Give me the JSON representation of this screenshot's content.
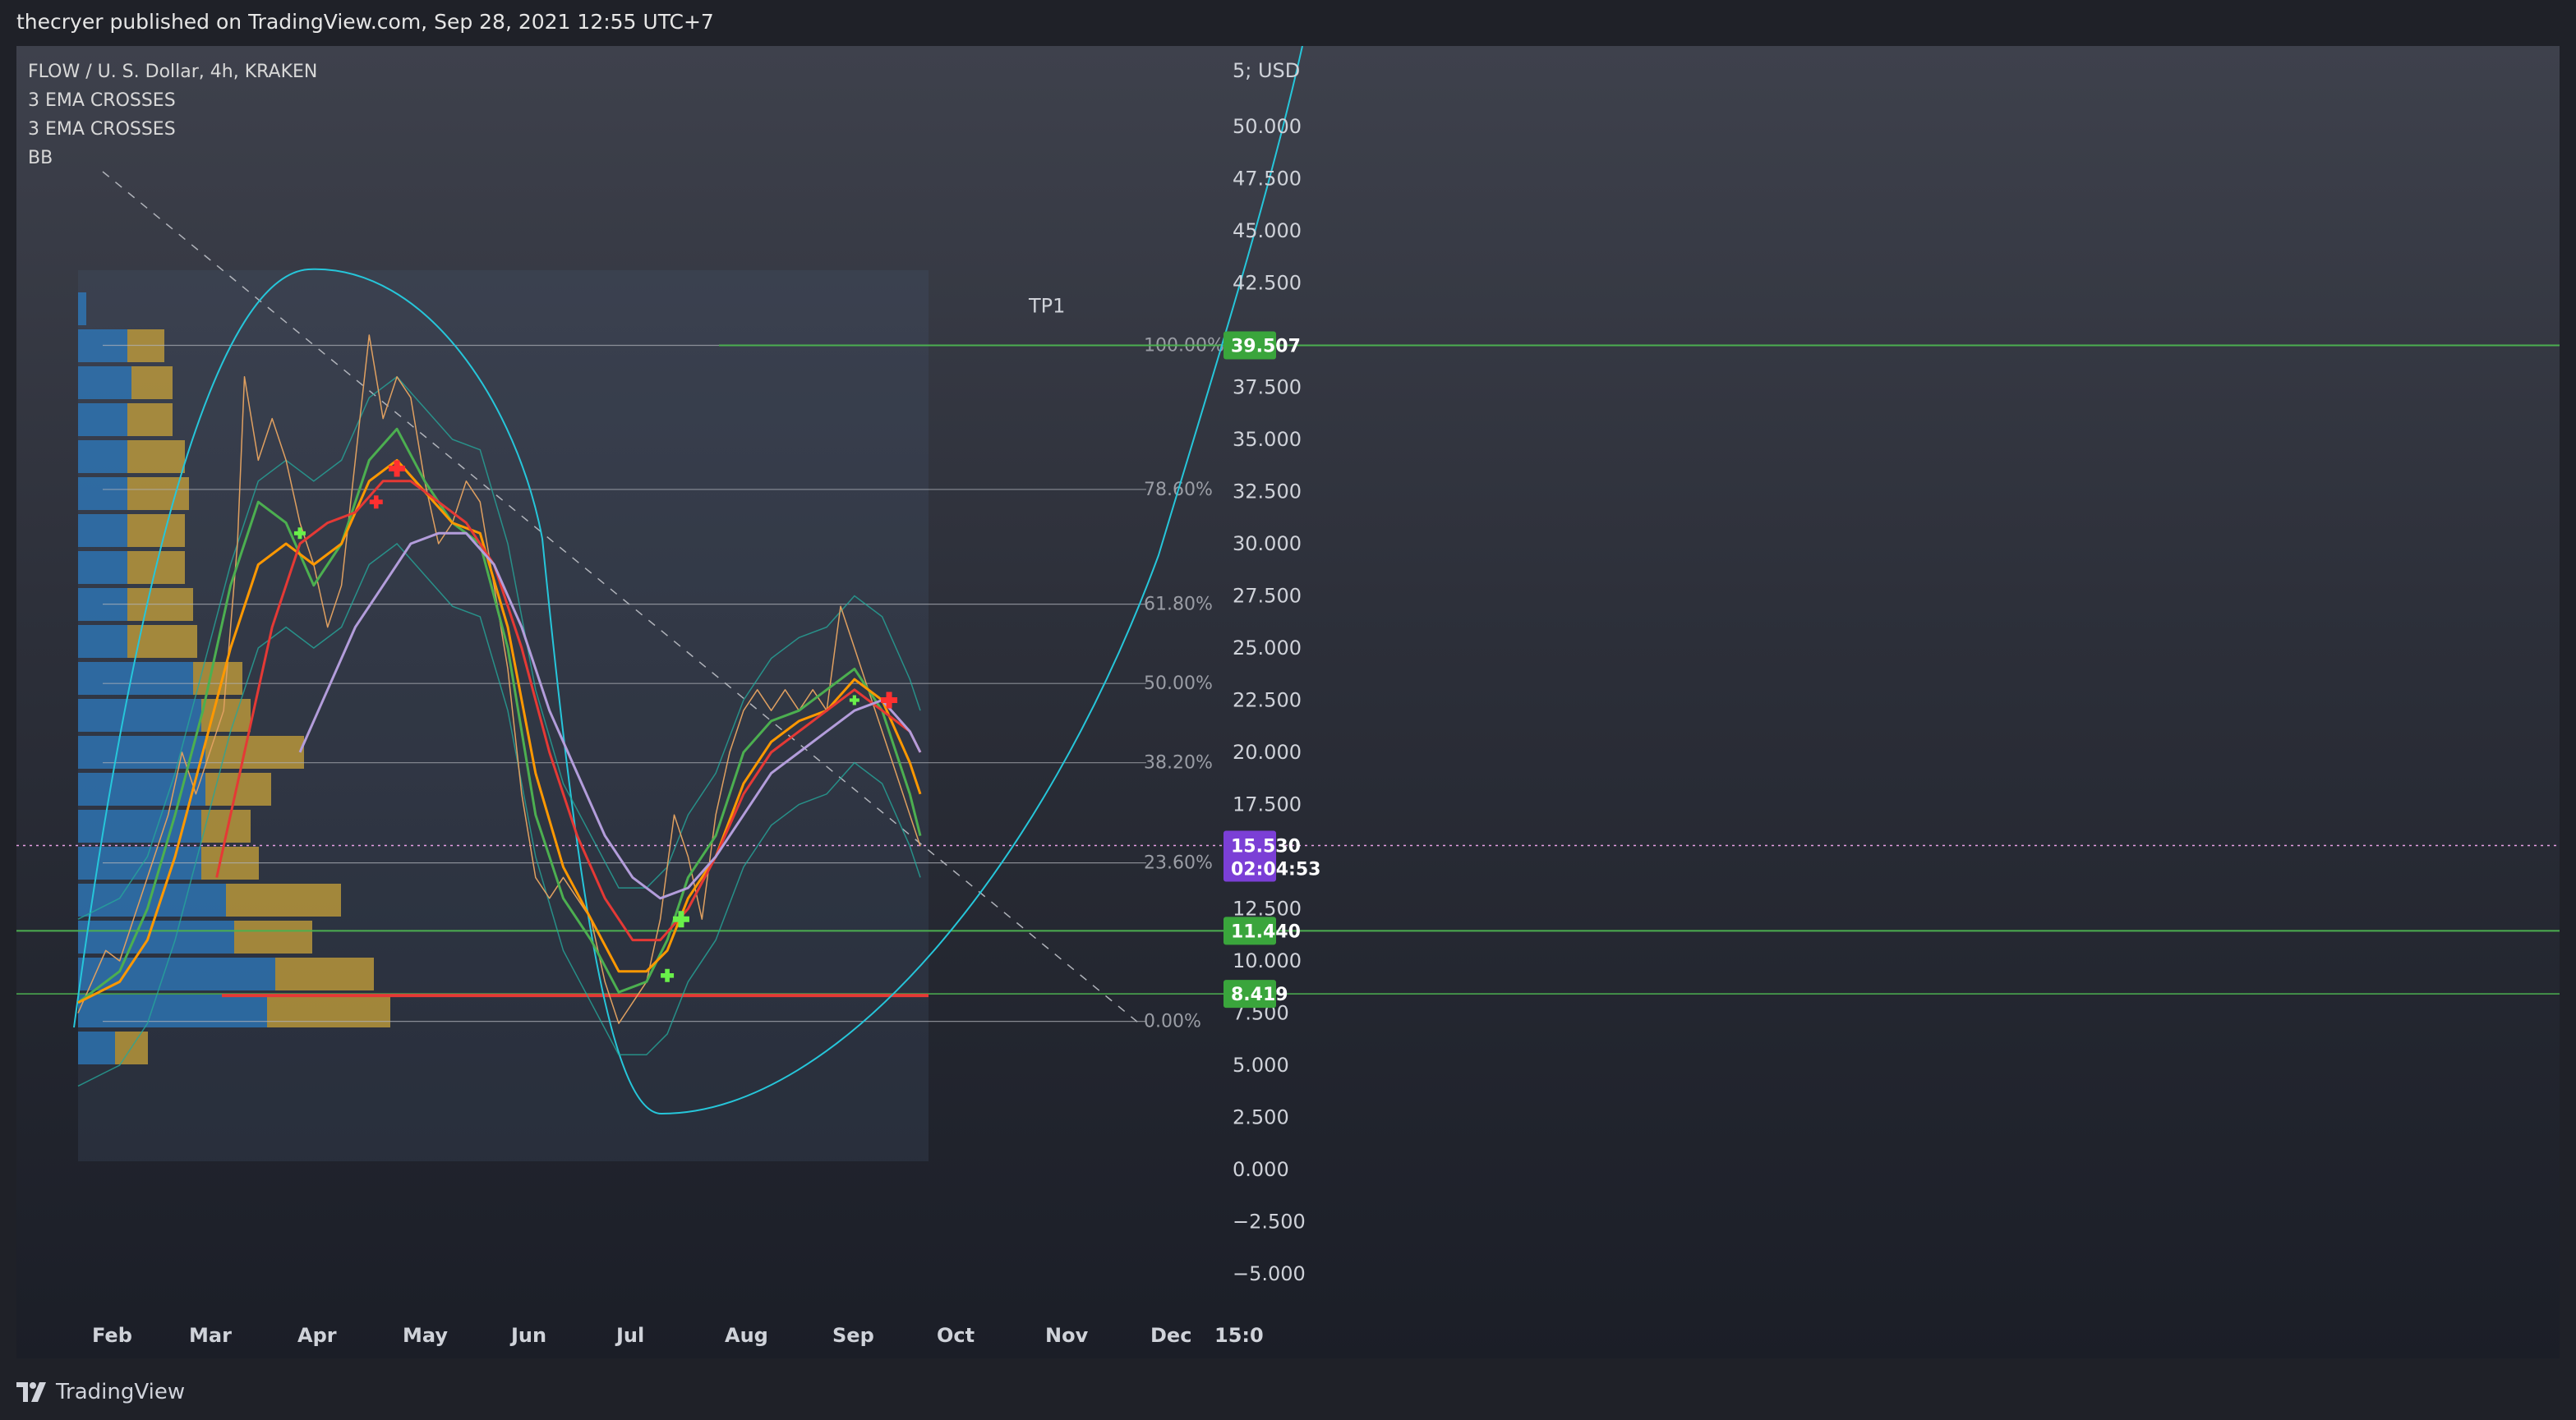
{
  "header": {
    "published": "thecryer published on TradingView.com, Sep 28, 2021 12:55 UTC+7"
  },
  "legend": {
    "symbol": "FLOW / U. S. Dollar, 4h, KRAKEN",
    "indicators": [
      "3 EMA CROSSES",
      "3 EMA CROSSES",
      "BB"
    ]
  },
  "footer": {
    "brand": "TradingView"
  },
  "colors": {
    "ema_fast": "#4caf50",
    "ema_mid": "#ff9800",
    "ema_slow": "#e53935",
    "ema_long": "#b39ddb",
    "bb": "#26a69a",
    "arc": "#26c6da",
    "candle": "#e0a060",
    "tp_line": "#4caf50",
    "support_red": "#e53935",
    "vp_up": "#2e7bbf",
    "vp_down": "#c9a33a"
  },
  "chart_data": {
    "type": "line",
    "title": "FLOW / U. S. Dollar, 4h, KRAKEN",
    "currency": "USD",
    "y_axis_label": "USD",
    "ylim": [
      -6,
      55
    ],
    "y_ticks": [
      "−5.000",
      "−2.500",
      "0.000",
      "2.500",
      "5.000",
      "7.500",
      "10.000",
      "12.500",
      "17.500",
      "20.000",
      "22.500",
      "25.000",
      "27.500",
      "30.000",
      "32.500",
      "35.000",
      "37.500",
      "42.500",
      "45.000",
      "47.500",
      "50.000"
    ],
    "x_labels": [
      "Feb",
      "Mar",
      "Apr",
      "May",
      "Jun",
      "Jul",
      "Aug",
      "Sep",
      "Oct",
      "Nov",
      "Dec",
      "15:0"
    ],
    "fib_levels": [
      {
        "label": "100.00%",
        "value": 39.507
      },
      {
        "label": "78.60%",
        "value": 32.6
      },
      {
        "label": "61.80%",
        "value": 27.1
      },
      {
        "label": "50.00%",
        "value": 23.3
      },
      {
        "label": "38.20%",
        "value": 19.5
      },
      {
        "label": "23.60%",
        "value": 14.7
      },
      {
        "label": "0.00%",
        "value": 7.1
      }
    ],
    "price_badges": [
      {
        "label": "39.507",
        "value": 39.507
      },
      {
        "label": "15.530",
        "sub": "02:04:53",
        "value": 15.53
      },
      {
        "label": "11.440",
        "value": 11.44
      },
      {
        "label": "8.419",
        "value": 8.419
      }
    ],
    "annotations": [
      {
        "label": "TP1",
        "value": 41.4
      }
    ],
    "series": [
      {
        "name": "price",
        "points": [
          [
            0,
            7.5
          ],
          [
            4,
            9
          ],
          [
            8,
            10.5
          ],
          [
            12,
            10
          ],
          [
            16,
            12
          ],
          [
            20,
            14
          ],
          [
            26,
            17
          ],
          [
            30,
            20
          ],
          [
            34,
            18
          ],
          [
            38,
            20
          ],
          [
            42,
            22
          ],
          [
            46,
            30
          ],
          [
            48,
            38
          ],
          [
            52,
            34
          ],
          [
            56,
            36
          ],
          [
            60,
            34
          ],
          [
            64,
            31
          ],
          [
            68,
            29
          ],
          [
            72,
            26
          ],
          [
            76,
            28
          ],
          [
            80,
            34
          ],
          [
            84,
            40
          ],
          [
            88,
            36
          ],
          [
            92,
            38
          ],
          [
            96,
            37
          ],
          [
            100,
            33
          ],
          [
            104,
            30
          ],
          [
            108,
            31
          ],
          [
            112,
            33
          ],
          [
            116,
            32
          ],
          [
            120,
            28
          ],
          [
            124,
            24
          ],
          [
            128,
            18
          ],
          [
            132,
            14
          ],
          [
            136,
            13
          ],
          [
            140,
            14
          ],
          [
            144,
            13
          ],
          [
            148,
            12
          ],
          [
            152,
            9
          ],
          [
            156,
            7
          ],
          [
            160,
            8
          ],
          [
            164,
            9
          ],
          [
            168,
            12
          ],
          [
            172,
            17
          ],
          [
            176,
            15
          ],
          [
            180,
            12
          ],
          [
            184,
            17
          ],
          [
            188,
            20
          ],
          [
            192,
            22
          ],
          [
            196,
            23
          ],
          [
            200,
            22
          ],
          [
            204,
            23
          ],
          [
            208,
            22
          ],
          [
            212,
            23
          ],
          [
            216,
            22
          ],
          [
            220,
            27
          ],
          [
            224,
            25
          ],
          [
            228,
            23
          ],
          [
            232,
            21
          ],
          [
            236,
            19
          ],
          [
            240,
            17
          ],
          [
            243,
            15.5
          ]
        ]
      },
      {
        "name": "ema-fast",
        "points": [
          [
            0,
            8
          ],
          [
            12,
            9.5
          ],
          [
            20,
            12.5
          ],
          [
            28,
            17
          ],
          [
            36,
            22
          ],
          [
            44,
            28
          ],
          [
            52,
            32
          ],
          [
            60,
            31
          ],
          [
            68,
            28
          ],
          [
            76,
            30
          ],
          [
            84,
            34
          ],
          [
            92,
            35.5
          ],
          [
            100,
            33
          ],
          [
            108,
            31
          ],
          [
            116,
            30
          ],
          [
            124,
            25
          ],
          [
            132,
            17
          ],
          [
            140,
            13
          ],
          [
            148,
            11
          ],
          [
            156,
            8.5
          ],
          [
            164,
            9
          ],
          [
            170,
            11
          ],
          [
            176,
            14
          ],
          [
            184,
            16
          ],
          [
            192,
            20
          ],
          [
            200,
            21.5
          ],
          [
            208,
            22
          ],
          [
            216,
            23
          ],
          [
            224,
            24
          ],
          [
            232,
            22
          ],
          [
            240,
            18
          ],
          [
            243,
            16
          ]
        ]
      },
      {
        "name": "ema-mid",
        "points": [
          [
            0,
            8
          ],
          [
            12,
            9
          ],
          [
            20,
            11
          ],
          [
            28,
            15
          ],
          [
            36,
            20
          ],
          [
            44,
            25
          ],
          [
            52,
            29
          ],
          [
            60,
            30
          ],
          [
            68,
            29
          ],
          [
            76,
            30
          ],
          [
            84,
            33
          ],
          [
            92,
            34
          ],
          [
            100,
            32.5
          ],
          [
            108,
            31
          ],
          [
            116,
            30.5
          ],
          [
            124,
            26
          ],
          [
            132,
            19
          ],
          [
            140,
            14.5
          ],
          [
            148,
            12
          ],
          [
            156,
            9.5
          ],
          [
            164,
            9.5
          ],
          [
            170,
            10.5
          ],
          [
            176,
            13
          ],
          [
            184,
            15
          ],
          [
            192,
            18.5
          ],
          [
            200,
            20.5
          ],
          [
            208,
            21.5
          ],
          [
            216,
            22
          ],
          [
            224,
            23.5
          ],
          [
            232,
            22.5
          ],
          [
            240,
            19.5
          ],
          [
            243,
            18
          ]
        ]
      },
      {
        "name": "ema-slow",
        "points": [
          [
            40,
            14
          ],
          [
            48,
            20
          ],
          [
            56,
            26
          ],
          [
            64,
            30
          ],
          [
            72,
            31
          ],
          [
            80,
            31.5
          ],
          [
            88,
            33
          ],
          [
            96,
            33
          ],
          [
            104,
            32
          ],
          [
            112,
            31
          ],
          [
            120,
            29
          ],
          [
            128,
            25
          ],
          [
            136,
            20
          ],
          [
            144,
            16
          ],
          [
            152,
            13
          ],
          [
            160,
            11
          ],
          [
            168,
            11
          ],
          [
            176,
            12.5
          ],
          [
            184,
            15
          ],
          [
            192,
            18
          ],
          [
            200,
            20
          ],
          [
            208,
            21
          ],
          [
            216,
            22
          ],
          [
            224,
            23
          ],
          [
            232,
            22
          ],
          [
            240,
            21
          ],
          [
            243,
            20
          ]
        ]
      },
      {
        "name": "ema-long",
        "points": [
          [
            64,
            20
          ],
          [
            72,
            23
          ],
          [
            80,
            26
          ],
          [
            88,
            28
          ],
          [
            96,
            30
          ],
          [
            104,
            30.5
          ],
          [
            112,
            30.5
          ],
          [
            120,
            29
          ],
          [
            128,
            26
          ],
          [
            136,
            22
          ],
          [
            144,
            19
          ],
          [
            152,
            16
          ],
          [
            160,
            14
          ],
          [
            168,
            13
          ],
          [
            176,
            13.5
          ],
          [
            184,
            15
          ],
          [
            192,
            17
          ],
          [
            200,
            19
          ],
          [
            208,
            20
          ],
          [
            216,
            21
          ],
          [
            224,
            22
          ],
          [
            232,
            22.5
          ],
          [
            240,
            21
          ],
          [
            243,
            20
          ]
        ]
      }
    ]
  }
}
